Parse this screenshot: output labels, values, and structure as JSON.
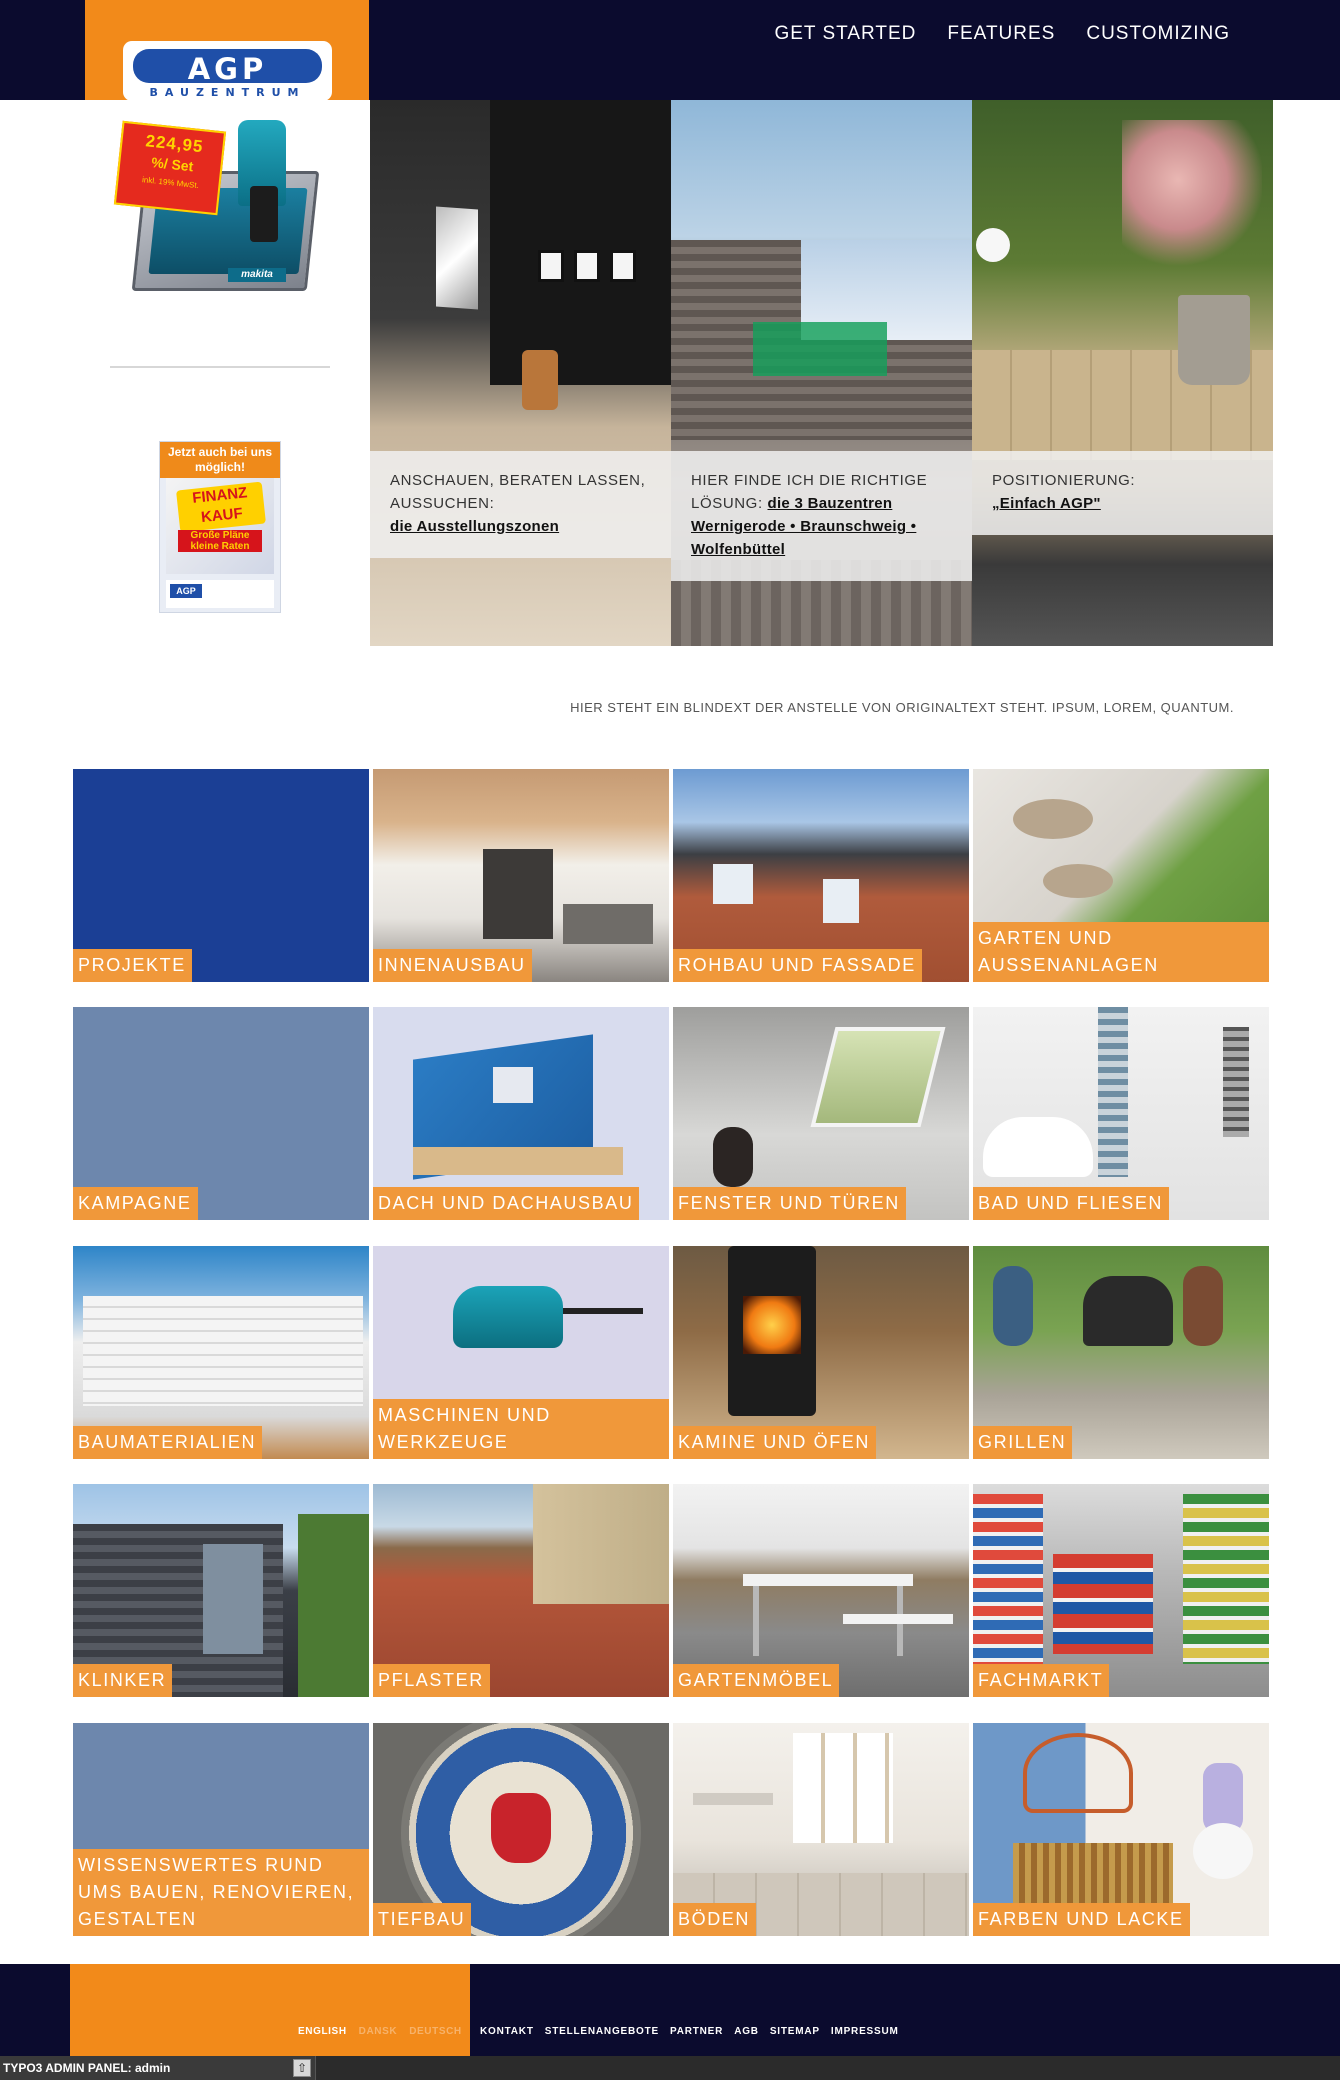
{
  "brand": {
    "logo_text": "AGP",
    "logo_sub": "BAUZENTRUM"
  },
  "topnav": [
    {
      "label": "GET STARTED"
    },
    {
      "label": "FEATURES"
    },
    {
      "label": "CUSTOMIZING"
    }
  ],
  "promo": {
    "price": "224,95",
    "unit": "%/ Set",
    "note": "inkl. 19% MwSt.",
    "brand": "makita"
  },
  "finanzkauf": {
    "headline": "Jetzt auch bei uns möglich!",
    "burst": "FINANZ KAUF",
    "tag": "Große Pläne kleine Raten",
    "logo": "AGP"
  },
  "hero": [
    {
      "lead": "ANSCHAUEN, BERATEN LASSEN, AUSSUCHEN:",
      "link": "die Ausstellungszonen"
    },
    {
      "lead": "HIER FINDE ICH DIE RICHTIGE LÖSUNG:",
      "link": "die 3 Bauzentren Wernigerode • Braunschweig • Wolfenbüttel"
    },
    {
      "lead": "POSITIONIERUNG:",
      "link": "„Einfach AGP\""
    }
  ],
  "intro_text": "HIER STEHT EIN BLINDEXT DER ANSTELLE VON ORIGINALTEXT STEHT. IPSUM, LOREM, QUANTUM.",
  "categories": [
    {
      "label": "PROJEKTE"
    },
    {
      "label": "INNENAUSBAU"
    },
    {
      "label": "ROHBAU UND FASSADE"
    },
    {
      "label": "GARTEN UND AUSSENANLAGEN"
    },
    {
      "label": "KAMPAGNE"
    },
    {
      "label": "DACH UND DACHAUSBAU"
    },
    {
      "label": "FENSTER UND TÜREN"
    },
    {
      "label": "BAD UND FLIESEN"
    },
    {
      "label": "BAUMATERIALIEN"
    },
    {
      "label": "MASCHINEN UND WERKZEUGE"
    },
    {
      "label": "KAMINE UND ÖFEN"
    },
    {
      "label": "GRILLEN"
    },
    {
      "label": "KLINKER"
    },
    {
      "label": "PFLASTER"
    },
    {
      "label": "GARTENMÖBEL"
    },
    {
      "label": "FACHMARKT"
    },
    {
      "label": "WISSENSWERTES RUND UMS BAUEN, RENOVIEREN, GESTALTEN"
    },
    {
      "label": "TIEFBAU"
    },
    {
      "label": "BÖDEN"
    },
    {
      "label": "FARBEN UND LACKE"
    }
  ],
  "footer": {
    "languages": [
      {
        "label": "ENGLISH",
        "active": true
      },
      {
        "label": "DANSK",
        "active": false
      },
      {
        "label": "DEUTSCH",
        "active": false
      }
    ],
    "links": [
      {
        "label": "KONTAKT"
      },
      {
        "label": "STELLENANGEBOTE"
      },
      {
        "label": "PARTNER"
      },
      {
        "label": "AGB"
      },
      {
        "label": "SITEMAP"
      },
      {
        "label": "IMPRESSUM"
      }
    ]
  },
  "admin_panel": {
    "label": "TYPO3 ADMIN PANEL: admin"
  },
  "colors": {
    "navy": "#0b0b2e",
    "orange": "#f28a1a",
    "label_orange": "#f0983a",
    "blue": "#1b3f95",
    "slate": "#6d87ad"
  }
}
